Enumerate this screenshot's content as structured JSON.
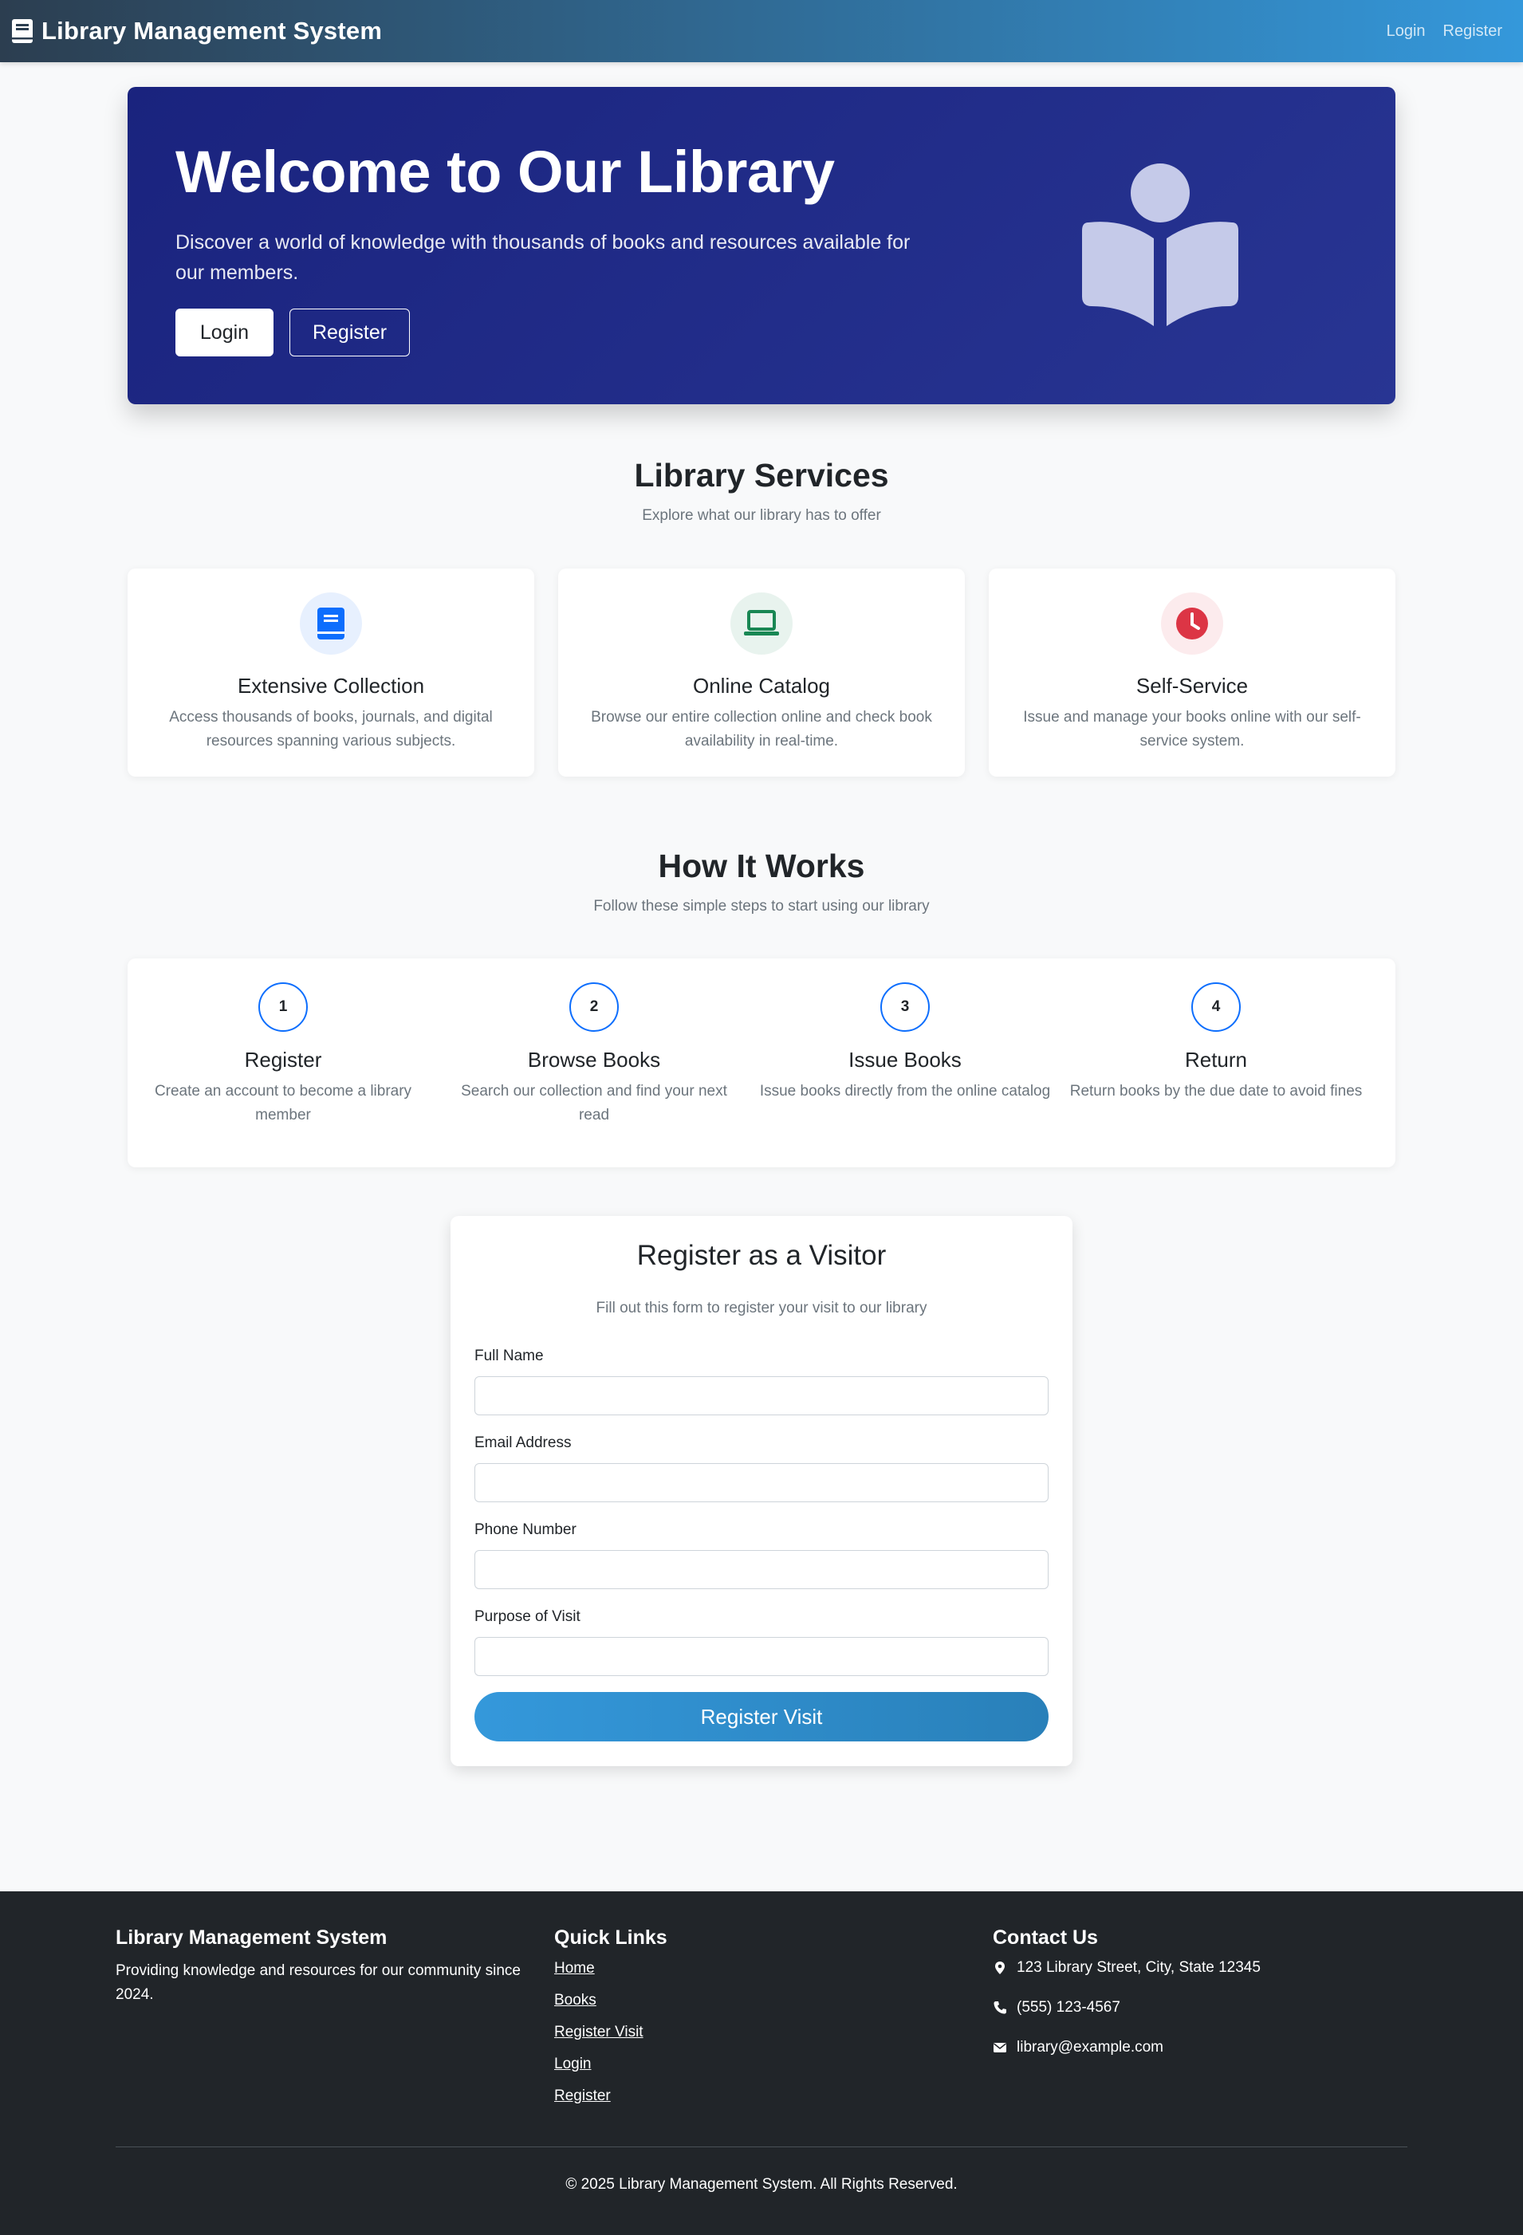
{
  "navbar": {
    "brand": "Library Management System",
    "links": [
      "Login",
      "Register"
    ]
  },
  "hero": {
    "title": "Welcome to Our Library",
    "subtitle": "Discover a world of knowledge with thousands of books and resources available for our members.",
    "login_label": "Login",
    "register_label": "Register",
    "icon": "book-reader-icon"
  },
  "services": {
    "title": "Library Services",
    "subtitle": "Explore what our library has to offer",
    "items": [
      {
        "title": "Extensive Collection",
        "desc": "Access thousands of books, journals, and digital resources spanning various subjects.",
        "icon": "book-icon",
        "color": "#0d6efd",
        "bg": "#e7f0fe"
      },
      {
        "title": "Online Catalog",
        "desc": "Browse our entire collection online and check book availability in real-time.",
        "icon": "laptop-icon",
        "color": "#198754",
        "bg": "#e8f3ee"
      },
      {
        "title": "Self-Service",
        "desc": "Issue and manage your books online with our self-service system.",
        "icon": "clock-icon",
        "color": "#dc3545",
        "bg": "#fcebed"
      }
    ]
  },
  "how": {
    "title": "How It Works",
    "subtitle": "Follow these simple steps to start using our library",
    "steps": [
      {
        "num": "1",
        "title": "Register",
        "desc": "Create an account to become a library member"
      },
      {
        "num": "2",
        "title": "Browse Books",
        "desc": "Search our collection and find your next read"
      },
      {
        "num": "3",
        "title": "Issue Books",
        "desc": "Issue books directly from the online catalog"
      },
      {
        "num": "4",
        "title": "Return",
        "desc": "Return books by the due date to avoid fines"
      }
    ]
  },
  "form": {
    "title": "Register as a Visitor",
    "subtitle": "Fill out this form to register your visit to our library",
    "fields": [
      {
        "label": "Full Name",
        "value": ""
      },
      {
        "label": "Email Address",
        "value": ""
      },
      {
        "label": "Phone Number",
        "value": ""
      },
      {
        "label": "Purpose of Visit",
        "value": ""
      }
    ],
    "submit_label": "Register Visit"
  },
  "footer": {
    "about_title": "Library Management System",
    "about_text": "Providing knowledge and resources for our community since 2024.",
    "links_title": "Quick Links",
    "links": [
      "Home",
      "Books",
      "Register Visit",
      "Login",
      "Register"
    ],
    "contact_title": "Contact Us",
    "address": "123 Library Street, City, State 12345",
    "phone": "(555) 123-4567",
    "email": "library@example.com",
    "copyright": "© 2025 Library Management System. All Rights Reserved."
  }
}
